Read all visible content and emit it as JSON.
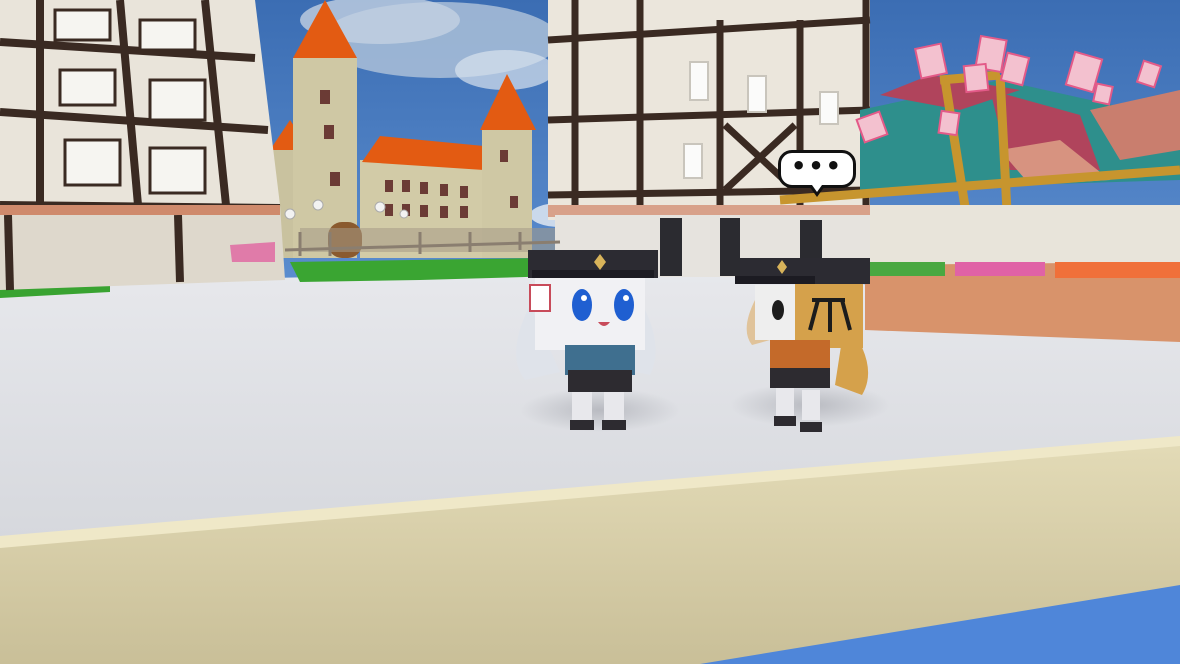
{
  "speech_bubble": {
    "text": "•••"
  },
  "colors": {
    "sky": "#3f6fb4",
    "ground": "#dfe1e6",
    "wall_plaster": "#e9e4da",
    "timber": "#3a2a22",
    "roof": "#e35b12",
    "castle_stone": "#cfc8a4",
    "ledge": "#d9cfa8",
    "water": "#4f86d9",
    "grass": "#3aa532",
    "awning_red": "#b0445c",
    "awning_teal": "#2e8f8c",
    "hat": "#2c2b32",
    "character_1_coat": "#3f6f8f",
    "character_2_coat": "#c46a2a",
    "box_head_2": "#d5a14b"
  },
  "scene": {
    "characters": [
      {
        "name": "blue-haired-officer",
        "icon": "officer-cap-character-icon"
      },
      {
        "name": "box-head-officer",
        "icon": "officer-cap-character-icon"
      }
    ],
    "floating_cards": 9
  }
}
